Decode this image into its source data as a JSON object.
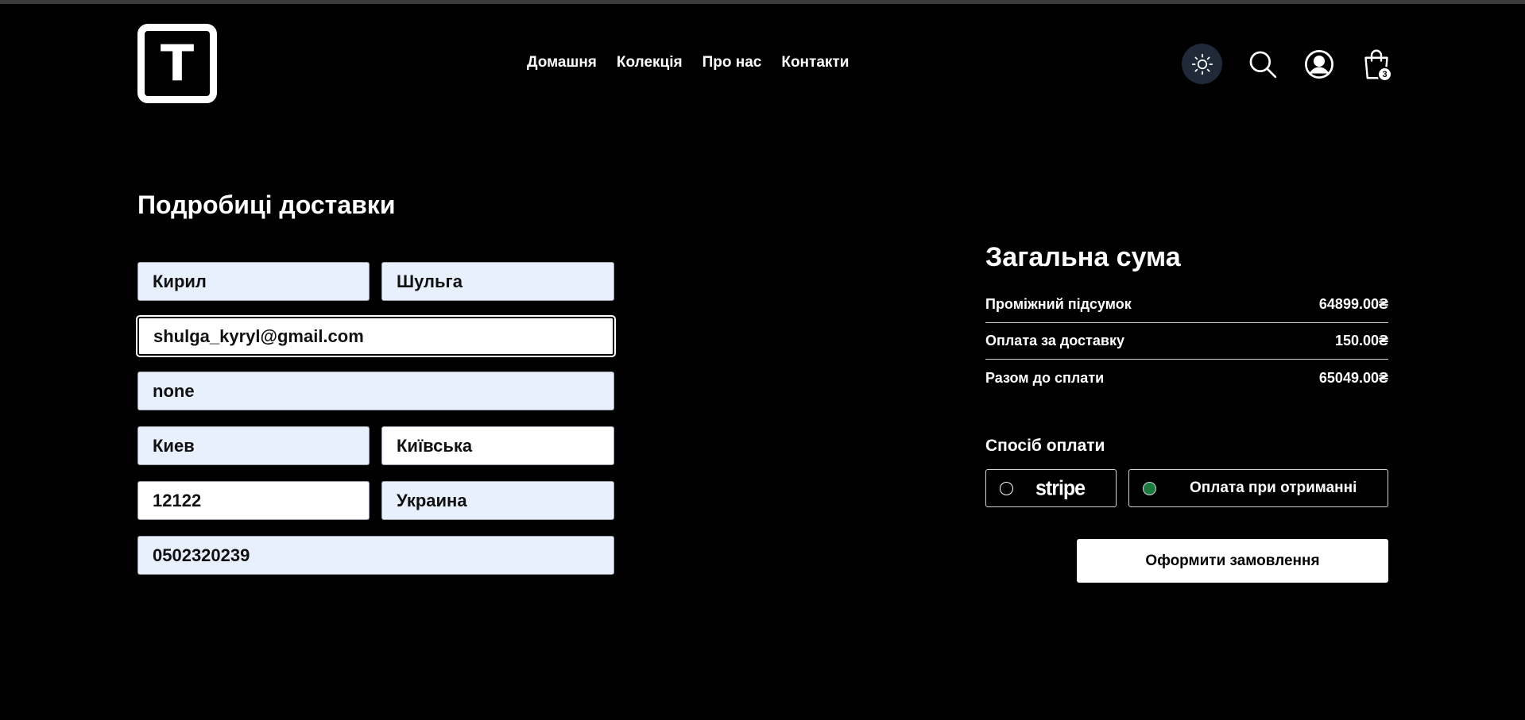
{
  "header": {
    "logo_letter": "T",
    "nav": [
      "Домашня",
      "Колекція",
      "Про нас",
      "Контакти"
    ],
    "cart_count": "3",
    "icons": [
      "sun-icon",
      "search-icon",
      "user-icon",
      "bag-icon"
    ]
  },
  "delivery": {
    "title": "Подробиці доставки",
    "first_name": "Кирил",
    "last_name": "Шульга",
    "email": "shulga_kyryl@gmail.com",
    "address": "none",
    "city": "Киев",
    "region": "Київська",
    "zip": "12122",
    "country": "Украина",
    "phone": "0502320239"
  },
  "summary": {
    "title": "Загальна сума",
    "rows": [
      {
        "label": "Проміжний підсумок",
        "value": "64899.00₴"
      },
      {
        "label": "Оплата за доставку",
        "value": "150.00₴"
      },
      {
        "label": "Разом до сплати",
        "value": "65049.00₴"
      }
    ]
  },
  "payment": {
    "title": "Спосіб оплати",
    "stripe_label": "stripe",
    "cash_label": "Оплата при отриманні",
    "selected": "cash",
    "selected_color": "#1b7a3e"
  },
  "order_button": "Оформити замовлення"
}
